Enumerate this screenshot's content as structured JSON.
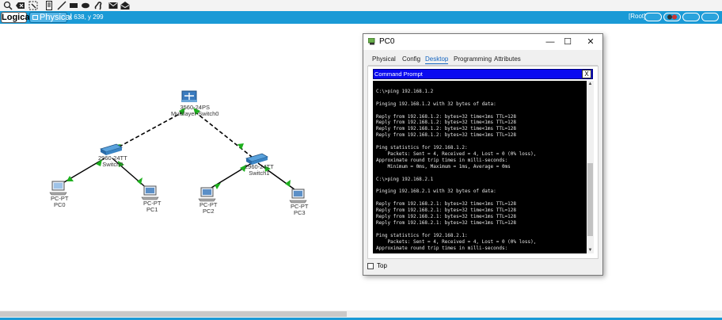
{
  "toolbar": {
    "icons": [
      "zoom-icon",
      "delete-icon",
      "select-area-icon",
      "note-icon",
      "draw-line-icon",
      "rectangle-icon",
      "ellipse-icon",
      "freeform-icon",
      "pdu-icon",
      "complex-pdu-icon"
    ]
  },
  "modebar": {
    "logical_label": "Logical",
    "physical_label": "Physical",
    "coords": "x 638, y 299",
    "root_label": "[Root]"
  },
  "topology": {
    "devices": [
      {
        "id": "multilayer",
        "model": "3560-24PS",
        "name": "Multilayer Switch0"
      },
      {
        "id": "switch0",
        "model": "2960-24TT",
        "name": "Switch0"
      },
      {
        "id": "switch1",
        "model": "2960-24TT",
        "name": "Switch1"
      },
      {
        "id": "pc0",
        "model": "PC-PT",
        "name": "PC0"
      },
      {
        "id": "pc1",
        "model": "PC-PT",
        "name": "PC1"
      },
      {
        "id": "pc2",
        "model": "PC-PT",
        "name": "PC2"
      },
      {
        "id": "pc3",
        "model": "PC-PT",
        "name": "PC3"
      }
    ],
    "link_color": "#1db01d"
  },
  "window": {
    "title": "PC0",
    "minimize": "—",
    "maximize": "☐",
    "close": "✕",
    "tabs": [
      "Physical",
      "Config",
      "Desktop",
      "Programming",
      "Attributes"
    ],
    "active_tab": "Desktop",
    "cmd_title": "Command Prompt",
    "cmd_close": "X",
    "terminal_lines": [
      "",
      "C:\\>ping 192.168.1.2",
      "",
      "Pinging 192.168.1.2 with 32 bytes of data:",
      "",
      "Reply from 192.168.1.2: bytes=32 time<1ms TTL=128",
      "Reply from 192.168.1.2: bytes=32 time<1ms TTL=128",
      "Reply from 192.168.1.2: bytes=32 time<1ms TTL=128",
      "Reply from 192.168.1.2: bytes=32 time<1ms TTL=128",
      "",
      "Ping statistics for 192.168.1.2:",
      "    Packets: Sent = 4, Received = 4, Lost = 0 (0% loss),",
      "Approximate round trip times in milli-seconds:",
      "    Minimum = 0ms, Maximum = 1ms, Average = 0ms",
      "",
      "C:\\>ping 192.168.2.1",
      "",
      "Pinging 192.168.2.1 with 32 bytes of data:",
      "",
      "Reply from 192.168.2.1: bytes=32 time<1ms TTL=128",
      "Reply from 192.168.2.1: bytes=32 time<1ms TTL=128",
      "Reply from 192.168.2.1: bytes=32 time<1ms TTL=128",
      "Reply from 192.168.2.1: bytes=32 time<1ms TTL=128",
      "",
      "Ping statistics for 192.168.2.1:",
      "    Packets: Sent = 4, Received = 4, Lost = 0 (0% loss),",
      "Approximate round trip times in milli-seconds:"
    ],
    "top_label": "Top"
  }
}
